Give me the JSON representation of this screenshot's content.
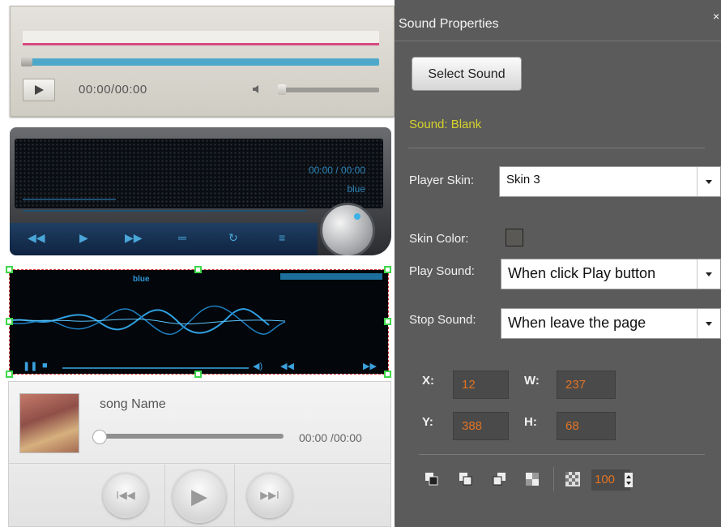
{
  "players": {
    "skin1": {
      "time": "00:00/00:00"
    },
    "skin2": {
      "time": "00:00 / 00:00",
      "color_label": "blue"
    },
    "skin3": {
      "color_label": "blue"
    },
    "skin4": {
      "song_name": "song Name",
      "time": "00:00 /00:00"
    }
  },
  "panel": {
    "title": "Sound Properties",
    "close_glyph": "×",
    "select_sound_label": "Select Sound",
    "sound_status": "Sound: Blank",
    "player_skin": {
      "label": "Player Skin:",
      "value": "Skin 3"
    },
    "skin_color": {
      "label": "Skin Color:",
      "value": "#5a5955"
    },
    "play_sound": {
      "label": "Play Sound:",
      "value": "When click Play button"
    },
    "stop_sound": {
      "label": "Stop Sound:",
      "value": "When leave the page"
    },
    "coords": {
      "x_label": "X:",
      "x": "12",
      "w_label": "W:",
      "w": "237",
      "y_label": "Y:",
      "y": "388",
      "h_label": "H:",
      "h": "68"
    },
    "arrange_icons": [
      "bring-to-front-icon",
      "bring-forward-icon",
      "send-backward-icon",
      "send-to-back-icon"
    ],
    "opacity": "100"
  },
  "colors": {
    "panel_bg": "#5b5b5b",
    "status_yellow": "#d6d22b",
    "coord_orange": "#e27324",
    "selection_green": "#3ed84a",
    "selection_red": "#d03030"
  }
}
